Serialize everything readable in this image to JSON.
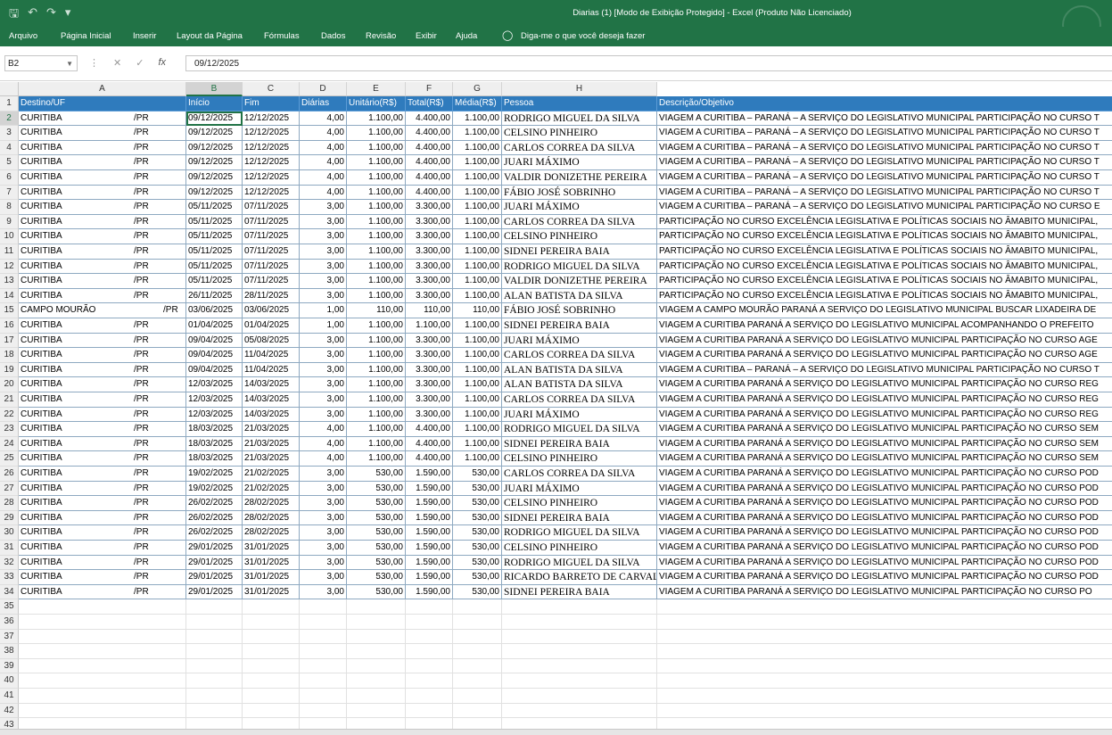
{
  "window": {
    "title": "Diarias (1)  [Modo de Exibição Protegido]  -  Excel (Produto Não Licenciado)",
    "qat": [
      "save-icon",
      "undo-icon",
      "redo-icon",
      "customize-icon"
    ]
  },
  "ribbon": {
    "tabs": [
      "Arquivo",
      "Página Inicial",
      "Inserir",
      "Layout da Página",
      "Fórmulas",
      "Dados",
      "Revisão",
      "Exibir",
      "Ajuda"
    ],
    "tell_me": "Diga-me o que você deseja fazer"
  },
  "formula_bar": {
    "name_box": "B2",
    "formula": "09/12/2025",
    "fx": "fx"
  },
  "columns": [
    "A",
    "B",
    "C",
    "D",
    "E",
    "F",
    "G",
    "H"
  ],
  "row_numbers": [
    "1",
    "2",
    "3",
    "4",
    "5",
    "6",
    "7",
    "8",
    "9",
    "10",
    "11",
    "12",
    "13",
    "14",
    "15",
    "16",
    "17",
    "18",
    "19",
    "20",
    "21",
    "22",
    "23",
    "24",
    "25",
    "26",
    "27",
    "28",
    "29",
    "30",
    "31",
    "32",
    "33",
    "34",
    "35",
    "36",
    "37",
    "38",
    "39",
    "40",
    "41",
    "42",
    "43"
  ],
  "header_row": [
    "Destino/UF",
    "Início",
    "Fim",
    "Diárias",
    "Unitário(R$)",
    "Total(R$)",
    "Média(R$)",
    "Pessoa",
    "Descrição/Objetivo"
  ],
  "rows": [
    [
      "CURITIBA",
      "/PR",
      "09/12/2025",
      "12/12/2025",
      "4,00",
      "1.100,00",
      "4.400,00",
      "1.100,00",
      "RODRIGO MIGUEL  DA SILVA",
      "VIAGEM A CURITIBA – PARANÁ – A SERVIÇO DO LEGISLATIVO MUNICIPAL PARTICIPAÇÃO NO CURSO T"
    ],
    [
      "CURITIBA",
      "/PR",
      "09/12/2025",
      "12/12/2025",
      "4,00",
      "1.100,00",
      "4.400,00",
      "1.100,00",
      "CELSINO PINHEIRO",
      "VIAGEM A CURITIBA – PARANÁ – A SERVIÇO DO LEGISLATIVO MUNICIPAL PARTICIPAÇÃO NO CURSO T"
    ],
    [
      "CURITIBA",
      "/PR",
      "09/12/2025",
      "12/12/2025",
      "4,00",
      "1.100,00",
      "4.400,00",
      "1.100,00",
      "CARLOS CORREA DA SILVA",
      "VIAGEM A CURITIBA – PARANÁ – A SERVIÇO DO LEGISLATIVO MUNICIPAL PARTICIPAÇÃO NO CURSO T"
    ],
    [
      "CURITIBA",
      "/PR",
      "09/12/2025",
      "12/12/2025",
      "4,00",
      "1.100,00",
      "4.400,00",
      "1.100,00",
      "JUARI MÁXIMO",
      "VIAGEM A CURITIBA – PARANÁ – A SERVIÇO DO LEGISLATIVO MUNICIPAL PARTICIPAÇÃO NO CURSO T"
    ],
    [
      "CURITIBA",
      "/PR",
      "09/12/2025",
      "12/12/2025",
      "4,00",
      "1.100,00",
      "4.400,00",
      "1.100,00",
      "VALDIR DONIZETHE PEREIRA",
      "VIAGEM A CURITIBA – PARANÁ – A SERVIÇO DO LEGISLATIVO MUNICIPAL PARTICIPAÇÃO NO CURSO T"
    ],
    [
      "CURITIBA",
      "/PR",
      "09/12/2025",
      "12/12/2025",
      "4,00",
      "1.100,00",
      "4.400,00",
      "1.100,00",
      "FÁBIO JOSÉ SOBRINHO",
      "VIAGEM A CURITIBA – PARANÁ – A SERVIÇO DO LEGISLATIVO MUNICIPAL PARTICIPAÇÃO NO CURSO T"
    ],
    [
      "CURITIBA",
      "/PR",
      "05/11/2025",
      "07/11/2025",
      "3,00",
      "1.100,00",
      "3.300,00",
      "1.100,00",
      "JUARI MÁXIMO",
      "VIAGEM A CURITIBA – PARANÁ – A SERVIÇO DO LEGISLATIVO MUNICIPAL PARTICIPAÇÃO NO CURSO E"
    ],
    [
      "CURITIBA",
      "/PR",
      "05/11/2025",
      "07/11/2025",
      "3,00",
      "1.100,00",
      "3.300,00",
      "1.100,00",
      "CARLOS CORREA DA SILVA",
      "PARTICIPAÇÃO NO CURSO EXCELÊNCIA LEGISLATIVA E POLÍTICAS SOCIAIS NO ÂMABITO MUNICIPAL,"
    ],
    [
      "CURITIBA",
      "/PR",
      "05/11/2025",
      "07/11/2025",
      "3,00",
      "1.100,00",
      "3.300,00",
      "1.100,00",
      "CELSINO PINHEIRO",
      "PARTICIPAÇÃO NO CURSO EXCELÊNCIA LEGISLATIVA E POLÍTICAS SOCIAIS NO ÂMABITO MUNICIPAL,"
    ],
    [
      "CURITIBA",
      "/PR",
      "05/11/2025",
      "07/11/2025",
      "3,00",
      "1.100,00",
      "3.300,00",
      "1.100,00",
      "SIDNEI PEREIRA BAIA",
      "PARTICIPAÇÃO NO CURSO EXCELÊNCIA LEGISLATIVA E POLÍTICAS SOCIAIS NO ÂMABITO MUNICIPAL,"
    ],
    [
      "CURITIBA",
      "/PR",
      "05/11/2025",
      "07/11/2025",
      "3,00",
      "1.100,00",
      "3.300,00",
      "1.100,00",
      "RODRIGO MIGUEL  DA SILVA",
      "PARTICIPAÇÃO NO CURSO EXCELÊNCIA LEGISLATIVA E POLÍTICAS SOCIAIS NO ÂMABITO MUNICIPAL,"
    ],
    [
      "CURITIBA",
      "/PR",
      "05/11/2025",
      "07/11/2025",
      "3,00",
      "1.100,00",
      "3.300,00",
      "1.100,00",
      "VALDIR DONIZETHE PEREIRA",
      "PARTICIPAÇÃO NO CURSO EXCELÊNCIA LEGISLATIVA E POLÍTICAS SOCIAIS NO ÂMABITO MUNICIPAL,"
    ],
    [
      "CURITIBA",
      "/PR",
      "26/11/2025",
      "28/11/2025",
      "3,00",
      "1.100,00",
      "3.300,00",
      "1.100,00",
      "ALAN BATISTA DA SILVA",
      "PARTICIPAÇÃO NO CURSO EXCELÊNCIA LEGISLATIVA E POLÍTICAS SOCIAIS NO ÂMABITO MUNICIPAL,"
    ],
    [
      "CAMPO MOURÃO",
      "/PR",
      "03/06/2025",
      "03/06/2025",
      "1,00",
      "110,00",
      "110,00",
      "110,00",
      "FÁBIO JOSÉ SOBRINHO",
      "VIAGEM A CAMPO MOURÃO PARANÁ A SERVIÇO DO LEGISLATIVO MUNICIPAL BUSCAR LIXADEIRA DE"
    ],
    [
      "CURITIBA",
      "/PR",
      "01/04/2025",
      "01/04/2025",
      "1,00",
      "1.100,00",
      "1.100,00",
      "1.100,00",
      "SIDNEI PEREIRA BAIA",
      "VIAGEM A CURITIBA  PARANÁ A SERVIÇO DO LEGISLATIVO MUNICIPAL ACOMPANHANDO O PREFEITO"
    ],
    [
      "CURITIBA",
      "/PR",
      "09/04/2025",
      "05/08/2025",
      "3,00",
      "1.100,00",
      "3.300,00",
      "1.100,00",
      "JUARI MÁXIMO",
      "VIAGEM A CURITIBA PARANÁ A SERVIÇO DO LEGISLATIVO MUNICIPAL PARTICIPAÇÃO NO CURSO AGE"
    ],
    [
      "CURITIBA",
      "/PR",
      "09/04/2025",
      "11/04/2025",
      "3,00",
      "1.100,00",
      "3.300,00",
      "1.100,00",
      "CARLOS CORREA DA SILVA",
      "VIAGEM A CURITIBA PARANÁ A SERVIÇO DO LEGISLATIVO MUNICIPAL PARTICIPAÇÃO NO CURSO AGE"
    ],
    [
      "CURITIBA",
      "/PR",
      "09/04/2025",
      "11/04/2025",
      "3,00",
      "1.100,00",
      "3.300,00",
      "1.100,00",
      "ALAN BATISTA DA SILVA",
      "VIAGEM A CURITIBA – PARANÁ – A SERVIÇO DO LEGISLATIVO MUNICIPAL PARTICIPAÇÃO NO CURSO T"
    ],
    [
      "CURITIBA",
      "/PR",
      "12/03/2025",
      "14/03/2025",
      "3,00",
      "1.100,00",
      "3.300,00",
      "1.100,00",
      "ALAN BATISTA DA SILVA",
      "VIAGEM A CURITIBA PARANÁ A SERVIÇO DO LEGISLATIVO MUNICIPAL PARTICIPAÇÃO NO CURSO REG"
    ],
    [
      "CURITIBA",
      "/PR",
      "12/03/2025",
      "14/03/2025",
      "3,00",
      "1.100,00",
      "3.300,00",
      "1.100,00",
      "CARLOS CORREA DA SILVA",
      "VIAGEM A CURITIBA PARANÁ A SERVIÇO DO LEGISLATIVO MUNICIPAL PARTICIPAÇÃO NO CURSO REG"
    ],
    [
      "CURITIBA",
      "/PR",
      "12/03/2025",
      "14/03/2025",
      "3,00",
      "1.100,00",
      "3.300,00",
      "1.100,00",
      "JUARI MÁXIMO",
      "VIAGEM A CURITIBA PARANÁ A SERVIÇO DO LEGISLATIVO MUNICIPAL PARTICIPAÇÃO NO CURSO REG"
    ],
    [
      "CURITIBA",
      "/PR",
      "18/03/2025",
      "21/03/2025",
      "4,00",
      "1.100,00",
      "4.400,00",
      "1.100,00",
      "RODRIGO MIGUEL  DA SILVA",
      "VIAGEM A CURITIBA PARANÁ A SERVIÇO DO LEGISLATIVO MUNICIPAL PARTICIPAÇÃO NO CURSO SEM"
    ],
    [
      "CURITIBA",
      "/PR",
      "18/03/2025",
      "21/03/2025",
      "4,00",
      "1.100,00",
      "4.400,00",
      "1.100,00",
      "SIDNEI PEREIRA BAIA",
      "VIAGEM A CURITIBA PARANÁ A SERVIÇO DO LEGISLATIVO MUNICIPAL PARTICIPAÇÃO NO CURSO SEM"
    ],
    [
      "CURITIBA",
      "/PR",
      "18/03/2025",
      "21/03/2025",
      "4,00",
      "1.100,00",
      "4.400,00",
      "1.100,00",
      "CELSINO PINHEIRO",
      "VIAGEM A CURITIBA PARANÁ A SERVIÇO DO LEGISLATIVO MUNICIPAL PARTICIPAÇÃO NO CURSO SEM"
    ],
    [
      "CURITIBA",
      "/PR",
      "19/02/2025",
      "21/02/2025",
      "3,00",
      "530,00",
      "1.590,00",
      "530,00",
      "CARLOS CORREA DA SILVA",
      "VIAGEM A CURITIBA PARANÁ A SERVIÇO DO LEGISLATIVO MUNICIPAL PARTICIPAÇÃO NO CURSO POD"
    ],
    [
      "CURITIBA",
      "/PR",
      "19/02/2025",
      "21/02/2025",
      "3,00",
      "530,00",
      "1.590,00",
      "530,00",
      "JUARI MÁXIMO",
      "VIAGEM A CURITIBA PARANÁ A SERVIÇO DO LEGISLATIVO MUNICIPAL PARTICIPAÇÃO NO CURSO POD"
    ],
    [
      "CURITIBA",
      "/PR",
      "26/02/2025",
      "28/02/2025",
      "3,00",
      "530,00",
      "1.590,00",
      "530,00",
      "CELSINO PINHEIRO",
      "VIAGEM A CURITIBA PARANÁ A SERVIÇO DO LEGISLATIVO MUNICIPAL PARTICIPAÇÃO NO CURSO POD"
    ],
    [
      "CURITIBA",
      "/PR",
      "26/02/2025",
      "28/02/2025",
      "3,00",
      "530,00",
      "1.590,00",
      "530,00",
      "SIDNEI PEREIRA BAIA",
      "VIAGEM A CURITIBA PARANÁ A SERVIÇO DO LEGISLATIVO MUNICIPAL PARTICIPAÇÃO NO CURSO POD"
    ],
    [
      "CURITIBA",
      "/PR",
      "26/02/2025",
      "28/02/2025",
      "3,00",
      "530,00",
      "1.590,00",
      "530,00",
      "RODRIGO MIGUEL  DA SILVA",
      "VIAGEM A CURITIBA PARANÁ A SERVIÇO DO LEGISLATIVO MUNICIPAL PARTICIPAÇÃO NO CURSO POD"
    ],
    [
      "CURITIBA",
      "/PR",
      "29/01/2025",
      "31/01/2025",
      "3,00",
      "530,00",
      "1.590,00",
      "530,00",
      "CELSINO PINHEIRO",
      "VIAGEM A CURITIBA PARANÁ A SERVIÇO DO LEGISLATIVO MUNICIPAL PARTICIPAÇÃO NO CURSO POD"
    ],
    [
      "CURITIBA",
      "/PR",
      "29/01/2025",
      "31/01/2025",
      "3,00",
      "530,00",
      "1.590,00",
      "530,00",
      "RODRIGO MIGUEL  DA SILVA",
      "VIAGEM A CURITIBA PARANÁ A SERVIÇO DO LEGISLATIVO MUNICIPAL PARTICIPAÇÃO NO CURSO POD"
    ],
    [
      "CURITIBA",
      "/PR",
      "29/01/2025",
      "31/01/2025",
      "3,00",
      "530,00",
      "1.590,00",
      "530,00",
      "RICARDO BARRETO DE CARVALHO",
      "VIAGEM A CURITIBA PARANÁ A SERVIÇO DO LEGISLATIVO MUNICIPAL PARTICIPAÇÃO NO CURSO POD"
    ],
    [
      "CURITIBA",
      "/PR",
      "29/01/2025",
      "31/01/2025",
      "3,00",
      "530,00",
      "1.590,00",
      "530,00",
      "SIDNEI PEREIRA BAIA",
      "VIAGEM A CURITIBA PARANÁ  A SERVIÇO DO LEGISLATIVO MUNICIPAL PARTICIPAÇÃO NO CURSO PO"
    ]
  ],
  "colors": {
    "excel_green": "#217346",
    "table_header": "#2f7bbd"
  }
}
